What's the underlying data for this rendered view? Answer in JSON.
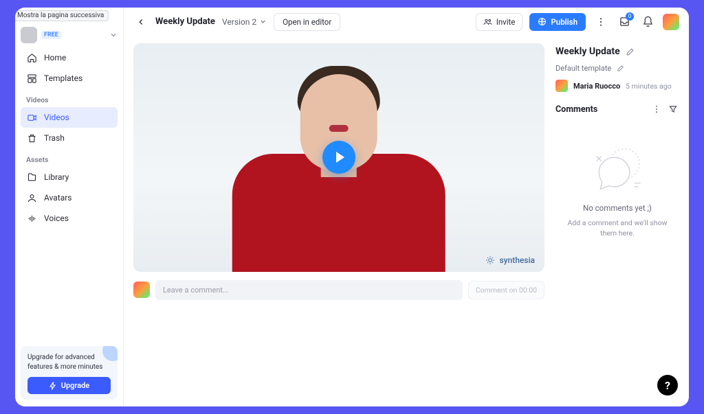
{
  "tooltip": "Mostra la pagina successiva",
  "workspace": {
    "plan_badge": "FREE"
  },
  "nav": {
    "home": "Home",
    "templates": "Templates"
  },
  "sections": {
    "videos_header": "Videos",
    "assets_header": "Assets"
  },
  "videos_nav": {
    "videos": "Videos",
    "trash": "Trash"
  },
  "assets_nav": {
    "library": "Library",
    "avatars": "Avatars",
    "voices": "Voices"
  },
  "upgrade": {
    "text": "Upgrade for advanced features & more minutes",
    "button": "Upgrade"
  },
  "topbar": {
    "title": "Weekly Update",
    "version_label": "Version 2",
    "open_editor": "Open in editor",
    "invite": "Invite",
    "publish": "Publish",
    "notif_count": "0"
  },
  "video": {
    "watermark": "synthesia"
  },
  "comment_bar": {
    "placeholder": "Leave a comment...",
    "timestamp_button": "Comment on 00:00"
  },
  "right_panel": {
    "title": "Weekly Update",
    "template_label": "Default template",
    "author": "Maria Ruocco",
    "author_time": "5 minutes ago",
    "comments_header": "Comments",
    "empty_title": "No comments yet ;)",
    "empty_sub": "Add a comment and we'll show them here."
  },
  "help_fab": "?"
}
